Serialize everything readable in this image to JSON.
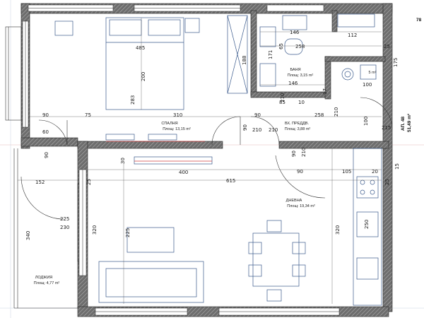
{
  "rooms": {
    "bedroom": {
      "name": "СПАЛНЯ",
      "area": "Площ: 13,15 m²"
    },
    "bathroom": {
      "name": "БАНЯ",
      "area": "Площ: 3,15 m²"
    },
    "wc": {
      "name": "",
      "area": "5 m²"
    },
    "hall": {
      "name": "ВХ. ПРЕДДВ.",
      "area": "Площ: 3,88 m²"
    },
    "living": {
      "name": "ДНЕВНА",
      "area": "Площ: 19,34 m²"
    },
    "loggia": {
      "name": "ЛОДЖИЯ",
      "area": "Площ: 4,77 m²"
    }
  },
  "apartment": {
    "label": "АП. 48",
    "area": "51,49 m²"
  },
  "corner_label": "78",
  "dimensions": {
    "d485": "485",
    "d200": "200",
    "d283": "283",
    "d188": "188",
    "d146top": "146",
    "d112": "112",
    "d258a": "258",
    "d25a": "25",
    "d175": "175",
    "d171": "171",
    "d65": "65",
    "d146b": "146",
    "d85": "85",
    "d210a": "210",
    "d210b": "210",
    "d100a": "100",
    "d100b": "100",
    "d90a": "90",
    "d75": "75",
    "d310": "310",
    "d258b": "258",
    "d15": "15",
    "d90b": "90",
    "d210c": "210",
    "d90c": "90",
    "d210d": "210",
    "d90d": "90",
    "d400": "400",
    "d615": "615",
    "d152": "152",
    "d225a": "225",
    "d230": "230",
    "d340": "340",
    "d225b": "225",
    "d320a": "320",
    "d320b": "320",
    "d250": "250",
    "d105": "105",
    "d20": "20",
    "d90e": "90",
    "d90f": "90",
    "d210e": "210",
    "d60": "60",
    "d30": "30",
    "d215": "215",
    "d10": "10",
    "d17": "17",
    "d25b": "25",
    "d25c": "25"
  }
}
